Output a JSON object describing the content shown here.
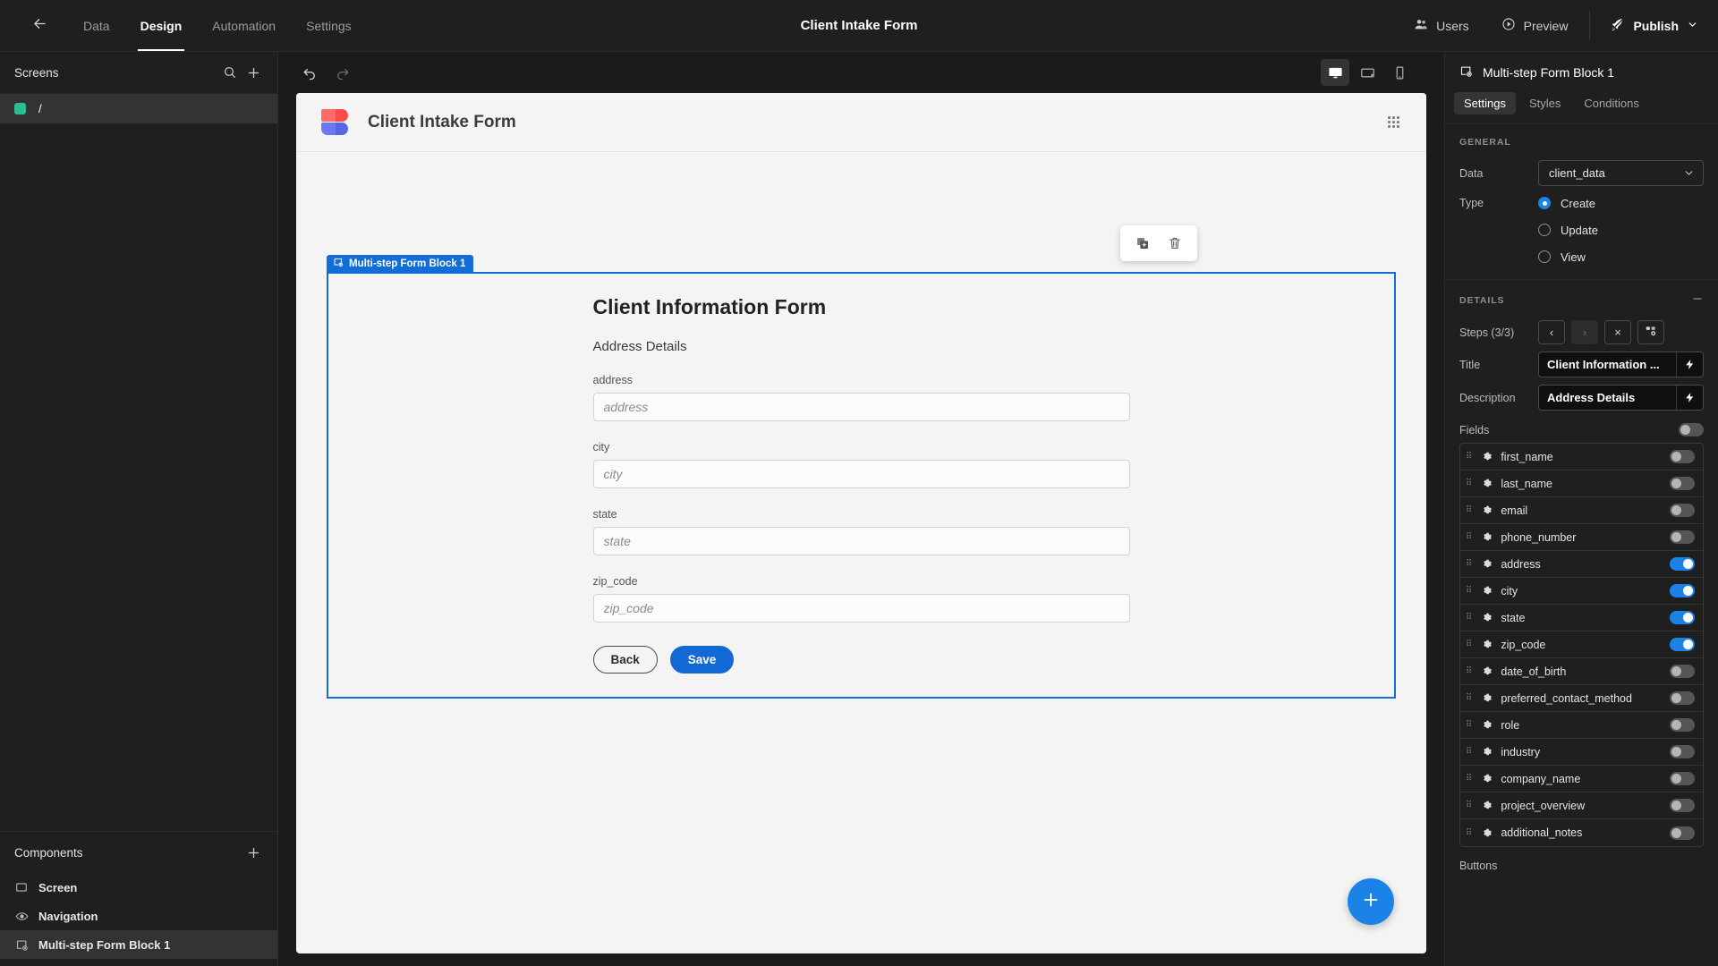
{
  "topbar": {
    "back_icon": "arrow-left-icon",
    "tabs": [
      {
        "label": "Data",
        "active": false
      },
      {
        "label": "Design",
        "active": true
      },
      {
        "label": "Automation",
        "active": false
      },
      {
        "label": "Settings",
        "active": false
      }
    ],
    "title": "Client Intake Form",
    "users_label": "Users",
    "preview_label": "Preview",
    "publish_label": "Publish"
  },
  "sidebar": {
    "screens_title": "Screens",
    "screens": [
      {
        "label": "/",
        "selected": true
      }
    ],
    "components_title": "Components",
    "components": [
      {
        "label": "Screen",
        "icon": "screen-icon",
        "selected": false
      },
      {
        "label": "Navigation",
        "icon": "eye-icon",
        "selected": false
      },
      {
        "label": "Multi-step Form Block 1",
        "icon": "form-block-icon",
        "selected": true
      }
    ]
  },
  "canvas": {
    "undo_icon": "undo-icon",
    "redo_icon": "redo-icon",
    "devices": [
      {
        "name": "desktop",
        "active": true
      },
      {
        "name": "tablet",
        "active": false
      },
      {
        "name": "mobile",
        "active": false
      }
    ],
    "app_name": "Client Intake Form",
    "grid_icon": "grid-icon",
    "float_toolbar": [
      {
        "name": "duplicate-icon"
      },
      {
        "name": "delete-icon"
      }
    ],
    "block_tag": "Multi-step Form Block 1",
    "form": {
      "title": "Client Information Form",
      "description": "Address Details",
      "fields": [
        {
          "label": "address",
          "placeholder": "address"
        },
        {
          "label": "city",
          "placeholder": "city"
        },
        {
          "label": "state",
          "placeholder": "state"
        },
        {
          "label": "zip_code",
          "placeholder": "zip_code"
        }
      ],
      "back_label": "Back",
      "save_label": "Save"
    },
    "fab_icon": "plus-icon"
  },
  "rpanel": {
    "title": "Multi-step Form Block 1",
    "tabs": [
      {
        "label": "Settings",
        "active": true
      },
      {
        "label": "Styles",
        "active": false
      },
      {
        "label": "Conditions",
        "active": false
      }
    ],
    "general_label": "GENERAL",
    "data_label": "Data",
    "data_value": "client_data",
    "type_label": "Type",
    "type_options": [
      {
        "label": "Create",
        "selected": true
      },
      {
        "label": "Update",
        "selected": false
      },
      {
        "label": "View",
        "selected": false
      }
    ],
    "details_label": "DETAILS",
    "steps_label": "Steps (3/3)",
    "step_prev": "‹",
    "step_next": "›",
    "step_remove": "×",
    "title_label": "Title",
    "title_value": "Client Information ...",
    "description_label": "Description",
    "description_value": "Address Details",
    "fields_label": "Fields",
    "fields_master_on": false,
    "fields": [
      {
        "name": "first_name",
        "on": false
      },
      {
        "name": "last_name",
        "on": false
      },
      {
        "name": "email",
        "on": false
      },
      {
        "name": "phone_number",
        "on": false
      },
      {
        "name": "address",
        "on": true
      },
      {
        "name": "city",
        "on": true
      },
      {
        "name": "state",
        "on": true
      },
      {
        "name": "zip_code",
        "on": true
      },
      {
        "name": "date_of_birth",
        "on": false
      },
      {
        "name": "preferred_contact_method",
        "on": false
      },
      {
        "name": "role",
        "on": false
      },
      {
        "name": "industry",
        "on": false
      },
      {
        "name": "company_name",
        "on": false
      },
      {
        "name": "project_overview",
        "on": false
      },
      {
        "name": "additional_notes",
        "on": false
      }
    ],
    "buttons_label": "Buttons"
  },
  "colors": {
    "accent": "#1b83e8",
    "selection": "#126ed6",
    "screen_dot": "#2bbd93"
  }
}
